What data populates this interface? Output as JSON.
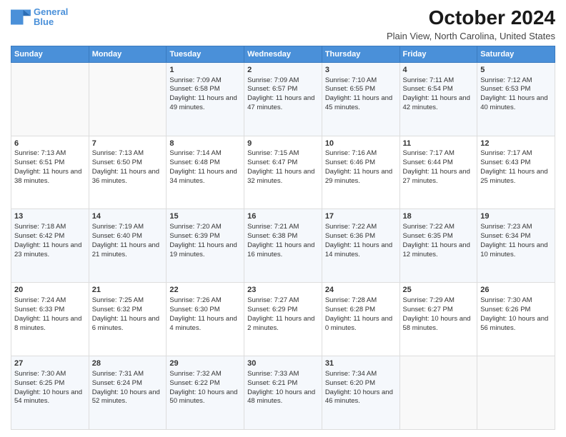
{
  "logo": {
    "line1": "General",
    "line2": "Blue"
  },
  "title": "October 2024",
  "subtitle": "Plain View, North Carolina, United States",
  "days_header": [
    "Sunday",
    "Monday",
    "Tuesday",
    "Wednesday",
    "Thursday",
    "Friday",
    "Saturday"
  ],
  "weeks": [
    [
      {
        "day": "",
        "info": ""
      },
      {
        "day": "",
        "info": ""
      },
      {
        "day": "1",
        "info": "Sunrise: 7:09 AM\nSunset: 6:58 PM\nDaylight: 11 hours and 49 minutes."
      },
      {
        "day": "2",
        "info": "Sunrise: 7:09 AM\nSunset: 6:57 PM\nDaylight: 11 hours and 47 minutes."
      },
      {
        "day": "3",
        "info": "Sunrise: 7:10 AM\nSunset: 6:55 PM\nDaylight: 11 hours and 45 minutes."
      },
      {
        "day": "4",
        "info": "Sunrise: 7:11 AM\nSunset: 6:54 PM\nDaylight: 11 hours and 42 minutes."
      },
      {
        "day": "5",
        "info": "Sunrise: 7:12 AM\nSunset: 6:53 PM\nDaylight: 11 hours and 40 minutes."
      }
    ],
    [
      {
        "day": "6",
        "info": "Sunrise: 7:13 AM\nSunset: 6:51 PM\nDaylight: 11 hours and 38 minutes."
      },
      {
        "day": "7",
        "info": "Sunrise: 7:13 AM\nSunset: 6:50 PM\nDaylight: 11 hours and 36 minutes."
      },
      {
        "day": "8",
        "info": "Sunrise: 7:14 AM\nSunset: 6:48 PM\nDaylight: 11 hours and 34 minutes."
      },
      {
        "day": "9",
        "info": "Sunrise: 7:15 AM\nSunset: 6:47 PM\nDaylight: 11 hours and 32 minutes."
      },
      {
        "day": "10",
        "info": "Sunrise: 7:16 AM\nSunset: 6:46 PM\nDaylight: 11 hours and 29 minutes."
      },
      {
        "day": "11",
        "info": "Sunrise: 7:17 AM\nSunset: 6:44 PM\nDaylight: 11 hours and 27 minutes."
      },
      {
        "day": "12",
        "info": "Sunrise: 7:17 AM\nSunset: 6:43 PM\nDaylight: 11 hours and 25 minutes."
      }
    ],
    [
      {
        "day": "13",
        "info": "Sunrise: 7:18 AM\nSunset: 6:42 PM\nDaylight: 11 hours and 23 minutes."
      },
      {
        "day": "14",
        "info": "Sunrise: 7:19 AM\nSunset: 6:40 PM\nDaylight: 11 hours and 21 minutes."
      },
      {
        "day": "15",
        "info": "Sunrise: 7:20 AM\nSunset: 6:39 PM\nDaylight: 11 hours and 19 minutes."
      },
      {
        "day": "16",
        "info": "Sunrise: 7:21 AM\nSunset: 6:38 PM\nDaylight: 11 hours and 16 minutes."
      },
      {
        "day": "17",
        "info": "Sunrise: 7:22 AM\nSunset: 6:36 PM\nDaylight: 11 hours and 14 minutes."
      },
      {
        "day": "18",
        "info": "Sunrise: 7:22 AM\nSunset: 6:35 PM\nDaylight: 11 hours and 12 minutes."
      },
      {
        "day": "19",
        "info": "Sunrise: 7:23 AM\nSunset: 6:34 PM\nDaylight: 11 hours and 10 minutes."
      }
    ],
    [
      {
        "day": "20",
        "info": "Sunrise: 7:24 AM\nSunset: 6:33 PM\nDaylight: 11 hours and 8 minutes."
      },
      {
        "day": "21",
        "info": "Sunrise: 7:25 AM\nSunset: 6:32 PM\nDaylight: 11 hours and 6 minutes."
      },
      {
        "day": "22",
        "info": "Sunrise: 7:26 AM\nSunset: 6:30 PM\nDaylight: 11 hours and 4 minutes."
      },
      {
        "day": "23",
        "info": "Sunrise: 7:27 AM\nSunset: 6:29 PM\nDaylight: 11 hours and 2 minutes."
      },
      {
        "day": "24",
        "info": "Sunrise: 7:28 AM\nSunset: 6:28 PM\nDaylight: 11 hours and 0 minutes."
      },
      {
        "day": "25",
        "info": "Sunrise: 7:29 AM\nSunset: 6:27 PM\nDaylight: 10 hours and 58 minutes."
      },
      {
        "day": "26",
        "info": "Sunrise: 7:30 AM\nSunset: 6:26 PM\nDaylight: 10 hours and 56 minutes."
      }
    ],
    [
      {
        "day": "27",
        "info": "Sunrise: 7:30 AM\nSunset: 6:25 PM\nDaylight: 10 hours and 54 minutes."
      },
      {
        "day": "28",
        "info": "Sunrise: 7:31 AM\nSunset: 6:24 PM\nDaylight: 10 hours and 52 minutes."
      },
      {
        "day": "29",
        "info": "Sunrise: 7:32 AM\nSunset: 6:22 PM\nDaylight: 10 hours and 50 minutes."
      },
      {
        "day": "30",
        "info": "Sunrise: 7:33 AM\nSunset: 6:21 PM\nDaylight: 10 hours and 48 minutes."
      },
      {
        "day": "31",
        "info": "Sunrise: 7:34 AM\nSunset: 6:20 PM\nDaylight: 10 hours and 46 minutes."
      },
      {
        "day": "",
        "info": ""
      },
      {
        "day": "",
        "info": ""
      }
    ]
  ]
}
